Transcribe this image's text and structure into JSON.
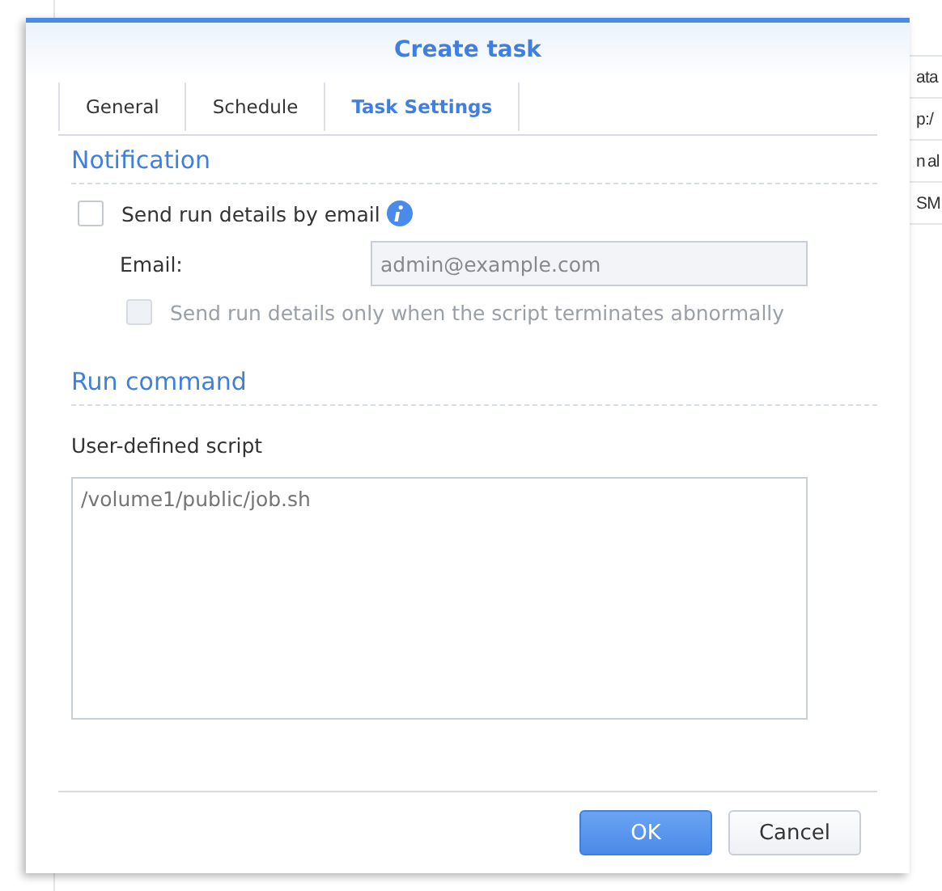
{
  "background": {
    "cut_cells": [
      "ata",
      "p:/",
      "n al",
      "SM"
    ]
  },
  "dialog": {
    "title": "Create task",
    "tabs": [
      {
        "label": "General",
        "selected": false
      },
      {
        "label": "Schedule",
        "selected": false
      },
      {
        "label": "Task Settings",
        "selected": true
      }
    ],
    "notification": {
      "heading": "Notification",
      "send_by_email": {
        "label": "Send run details by email",
        "checked": false
      },
      "email_label": "Email:",
      "email": {
        "placeholder": "admin@example.com",
        "disabled": true
      },
      "only_abnormal": {
        "label": "Send run details only when the script terminates abnormally",
        "checked": false,
        "disabled": true
      }
    },
    "run_command": {
      "heading": "Run command",
      "script_label": "User-defined script",
      "script": {
        "placeholder": "/volume1/public/job.sh"
      }
    },
    "buttons": [
      {
        "label": "OK",
        "kind": "primary"
      },
      {
        "label": "Cancel",
        "kind": "secondary"
      }
    ]
  }
}
